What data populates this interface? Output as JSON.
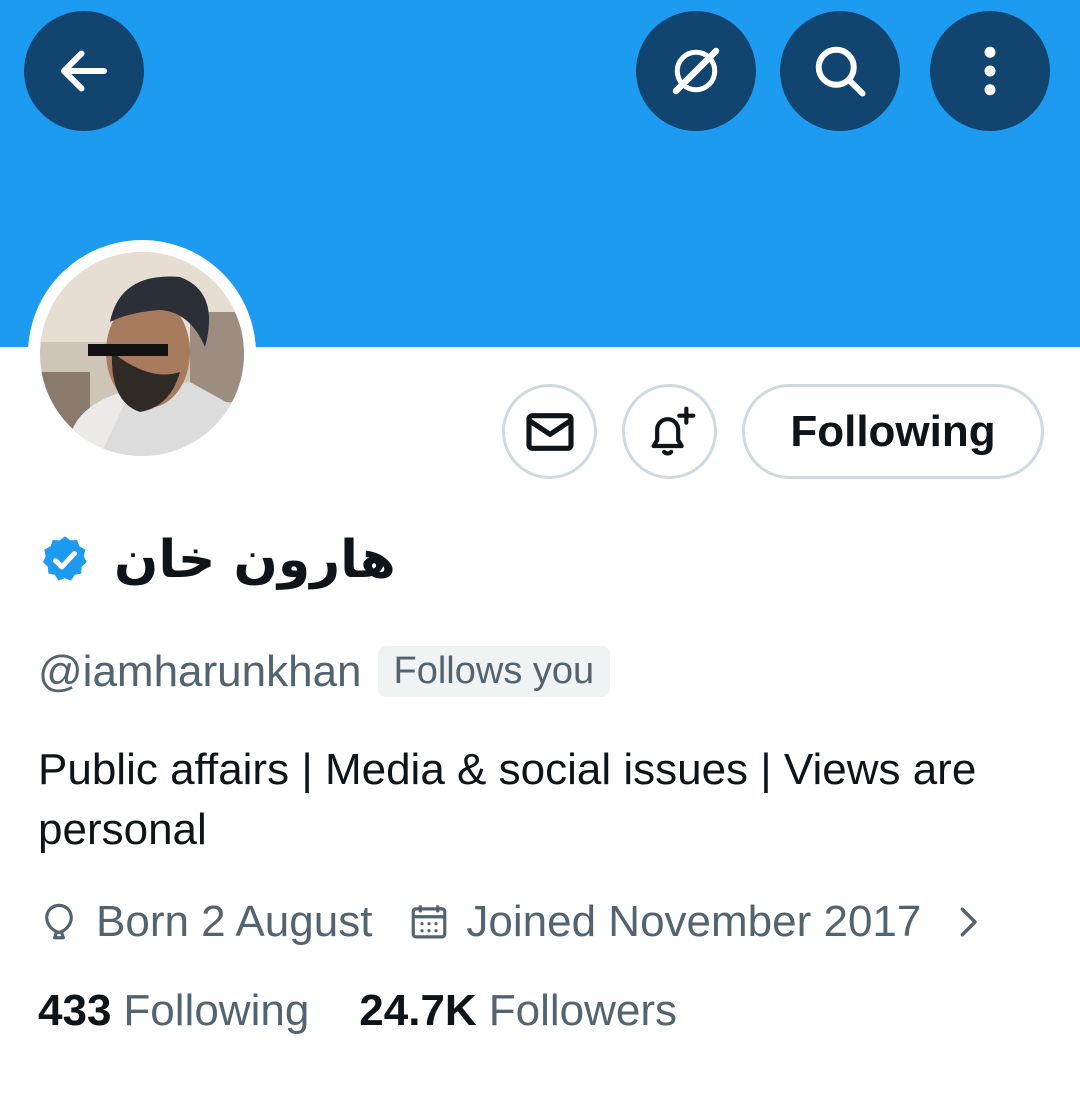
{
  "colors": {
    "banner": "#1d9bf0",
    "header_button": "#11456f",
    "verified_badge": "#1d9bf0",
    "secondary_text": "#536471",
    "primary_text": "#0f1419",
    "border": "#cfd9de"
  },
  "header": {
    "back_icon": "arrow-left-icon",
    "actions": [
      "explore-icon",
      "search-icon",
      "more-vertical-icon"
    ]
  },
  "profile": {
    "display_name": "هارون خان",
    "verified": true,
    "handle": "@iamharunkhan",
    "follows_you": "Follows you",
    "bio": "Public affairs | Media & social issues | Views are personal",
    "born": "Born 2 August",
    "joined": "Joined November 2017"
  },
  "actions": {
    "message_icon": "mail-icon",
    "notify_icon": "bell-plus-icon",
    "following_label": "Following"
  },
  "stats": {
    "following_count": "433",
    "following_label": "Following",
    "followers_count": "24.7K",
    "followers_label": "Followers"
  }
}
